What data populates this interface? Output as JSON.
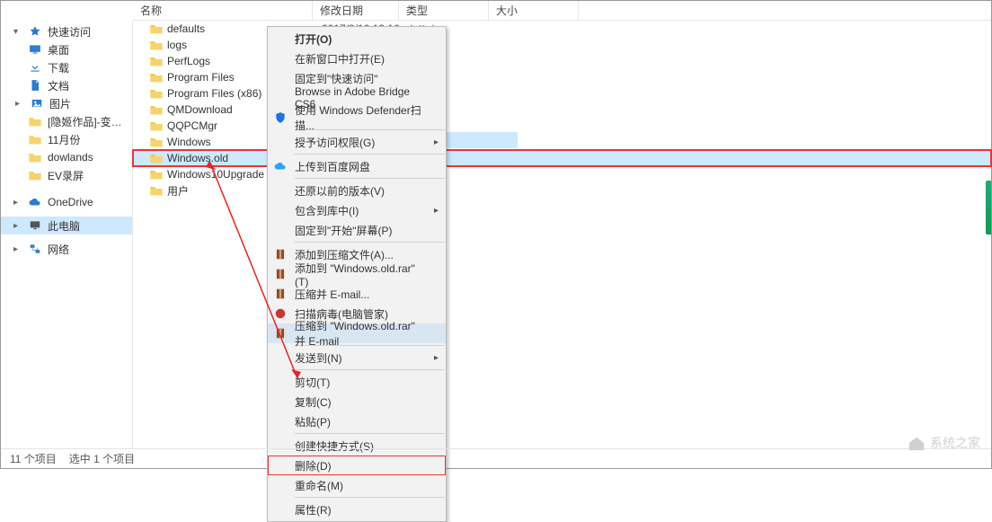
{
  "columns": {
    "name": "名称",
    "date": "修改日期",
    "type": "类型",
    "size": "大小"
  },
  "sidebar": {
    "quickaccess": {
      "label": "快速访问",
      "expanded": true
    },
    "items": [
      {
        "label": "桌面",
        "icon": "desktop"
      },
      {
        "label": "下载",
        "icon": "download"
      },
      {
        "label": "文档",
        "icon": "document"
      },
      {
        "label": "图片",
        "icon": "pictures"
      },
      {
        "label": "[隐姬作品]-变态者电",
        "icon": "folder"
      },
      {
        "label": "11月份",
        "icon": "folder"
      },
      {
        "label": "dowlands",
        "icon": "folder"
      },
      {
        "label": "EV录屏",
        "icon": "folder"
      }
    ],
    "onedrive": "OneDrive",
    "thispc": "此电脑",
    "network": "网络"
  },
  "files": [
    {
      "name": "defaults"
    },
    {
      "name": "logs"
    },
    {
      "name": "PerfLogs"
    },
    {
      "name": "Program Files"
    },
    {
      "name": "Program Files (x86)"
    },
    {
      "name": "QMDownload"
    },
    {
      "name": "QQPCMgr"
    },
    {
      "name": "Windows"
    },
    {
      "name": "Windows.old",
      "selected": true,
      "highlighted": true
    },
    {
      "name": "Windows10Upgrade"
    },
    {
      "name": "用户"
    }
  ],
  "details": {
    "date": "2017/9/10 13:16",
    "type": "文件夹"
  },
  "menu": {
    "open": "打开(O)",
    "open_new": "在新窗口中打开(E)",
    "pin_quick": "固定到\"快速访问\"",
    "bridge": "Browse in Adobe Bridge CS6",
    "defender": "使用 Windows Defender扫描...",
    "grant_access": "授予访问权限(G)",
    "baidu": "上传到百度网盘",
    "restore": "还原以前的版本(V)",
    "include": "包含到库中(I)",
    "pin_start": "固定到\"开始\"屏幕(P)",
    "rar_add": "添加到压缩文件(A)...",
    "rar_addto": "添加到 \"Windows.old.rar\"(T)",
    "rar_email": "压缩并 E-mail...",
    "rar_scan": "扫描病毒(电脑管家)",
    "rar_addto_email": "压缩到 \"Windows.old.rar\" 并 E-mail",
    "sendto": "发送到(N)",
    "cut": "剪切(T)",
    "copy": "复制(C)",
    "paste": "粘贴(P)",
    "shortcut": "创建快捷方式(S)",
    "delete": "删除(D)",
    "rename": "重命名(M)",
    "properties": "属性(R)"
  },
  "status": {
    "count": "11 个项目",
    "selected": "选中 1 个项目"
  },
  "watermark": "系统之家"
}
